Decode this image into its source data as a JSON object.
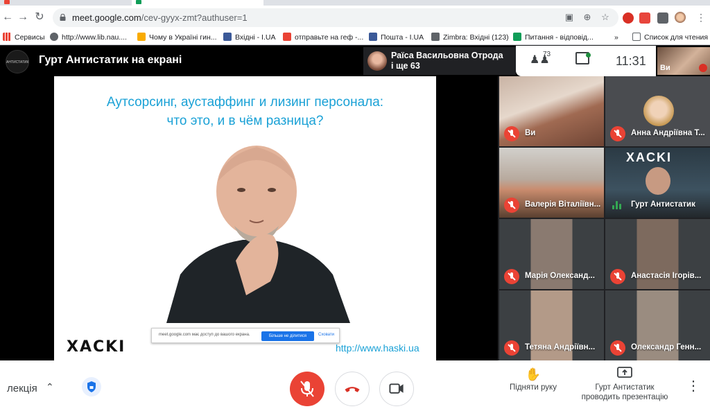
{
  "browser": {
    "url_host": "meet.google.com",
    "url_path": "/cev-gyyx-zmt?authuser=1",
    "bookmarks": [
      {
        "label": "Сервисы",
        "color": "#ea4335"
      },
      {
        "label": "http://www.lib.nau....",
        "color": "#5f6368"
      },
      {
        "label": "Чому в Україні гин...",
        "color": "#f9ab00"
      },
      {
        "label": "Вхідні - I.UA",
        "color": "#3b5998"
      },
      {
        "label": "отправьте на геф -...",
        "color": "#ea4335"
      },
      {
        "label": "Пошта - I.UA",
        "color": "#3b5998"
      },
      {
        "label": "Zimbra: Вхідні (123)",
        "color": "#5f6368"
      },
      {
        "label": "Питання - відповід...",
        "color": "#0f9d58"
      }
    ],
    "bookmarks_more": "»",
    "reading_list": "Список для чтения"
  },
  "meet": {
    "logo_text": "АНТИСТАТИК",
    "title": "Гурт Антистатик на екрані",
    "presenter_name_line1": "Раїса Васильовна Отрода",
    "presenter_name_line2": "і ще 63",
    "people_count": "73",
    "clock": "11:31",
    "self_label": "Ви"
  },
  "slide": {
    "title_line1": "Аутсорсинг, аустаффинг и лизинг персонала:",
    "title_line2": "что это, и в чём разница?",
    "logo": "XACKI",
    "url": "http://www.haski.ua",
    "share_text": "meet.google.com має доступ до вашого екрана.",
    "share_stop": "Більше не ділитися",
    "share_hide": "Сховати"
  },
  "participants": [
    {
      "name": "Ви",
      "muted": true
    },
    {
      "name": "Анна Андріївна Т...",
      "muted": true
    },
    {
      "name": "Валерія Віталіївн...",
      "muted": true
    },
    {
      "name": "Гурт Антистатик",
      "muted": false
    },
    {
      "name": "Марія Олександ...",
      "muted": true
    },
    {
      "name": "Анастасія Ігорів...",
      "muted": true
    },
    {
      "name": "Тетяна Андріївн...",
      "muted": true
    },
    {
      "name": "Олександр Генн...",
      "muted": true
    }
  ],
  "tile_badge": "XACKI",
  "controls": {
    "meeting_name": "лекція",
    "raise_hand": "Підняти руку",
    "presenting_line1": "Гурт Антистатик",
    "presenting_line2": "проводить презентацію"
  }
}
